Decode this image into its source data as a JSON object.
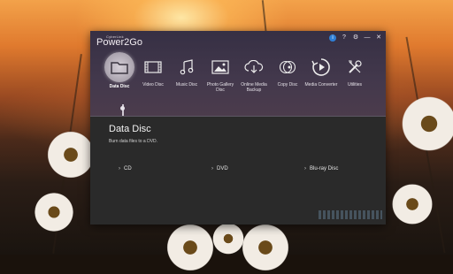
{
  "app": {
    "brand_small": "CyberLink",
    "brand": "Power2Go"
  },
  "window_controls": {
    "info": "i",
    "help": "?",
    "settings": "⚙",
    "minimize": "—",
    "close": "✕"
  },
  "nav": {
    "items": [
      {
        "label": "Data Disc",
        "icon": "folder-icon",
        "active": true
      },
      {
        "label": "Video Disc",
        "icon": "film-icon",
        "active": false
      },
      {
        "label": "Music Disc",
        "icon": "music-note-icon",
        "active": false
      },
      {
        "label": "Photo Gallery Disc",
        "icon": "photo-icon",
        "active": false
      },
      {
        "label": "Online Media Backup",
        "icon": "cloud-download-icon",
        "active": false
      },
      {
        "label": "Copy Disc",
        "icon": "copy-disc-icon",
        "active": false
      },
      {
        "label": "Media Converter",
        "icon": "media-converter-icon",
        "active": false
      },
      {
        "label": "Utilities",
        "icon": "tools-icon",
        "active": false
      }
    ]
  },
  "main": {
    "title": "Data Disc",
    "subtitle": "Burn data files to a DVD.",
    "options": [
      {
        "label": "CD"
      },
      {
        "label": "DVD"
      },
      {
        "label": "Blu-ray Disc"
      }
    ]
  },
  "colors": {
    "accent_blue": "#2f7fd6",
    "content_bg": "#2a2a2a"
  }
}
